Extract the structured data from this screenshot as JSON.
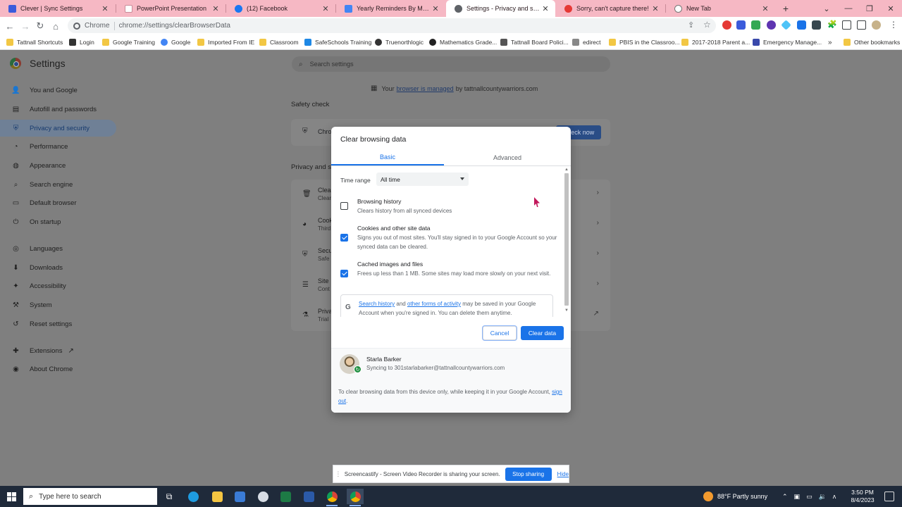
{
  "tabs": [
    {
      "title": "Clever | Sync Settings",
      "favicon_color": "#3b5bdb",
      "active": false
    },
    {
      "title": "PowerPoint Presentation",
      "favicon_color": "#f6b8c4",
      "active": false
    },
    {
      "title": "(12) Facebook",
      "favicon_color": "#1877f2",
      "active": false
    },
    {
      "title": "Yearly Reminders By Month - Go",
      "favicon_color": "#4285f4",
      "active": false
    },
    {
      "title": "Settings - Privacy and security",
      "favicon_color": "#5f6368",
      "active": true
    },
    {
      "title": "Sorry, can't capture there!",
      "favicon_color": "#e53935",
      "active": false
    },
    {
      "title": "New Tab",
      "favicon_color": "#5f6368",
      "active": false
    }
  ],
  "address_bar": {
    "site_label": "Chrome",
    "url": "chrome://settings/clearBrowserData"
  },
  "bookmarks": [
    {
      "label": "Tattnall Shortcuts",
      "color": "#f2c744"
    },
    {
      "label": "Login",
      "color": "#333333"
    },
    {
      "label": "Google Training",
      "color": "#f2c744"
    },
    {
      "label": "Google",
      "color": "#4285f4"
    },
    {
      "label": "Imported From IE",
      "color": "#f2c744"
    },
    {
      "label": "Classroom",
      "color": "#f2c744"
    },
    {
      "label": "SafeSchools Training",
      "color": "#1e88e5"
    },
    {
      "label": "Truenorthlogic",
      "color": "#333333"
    },
    {
      "label": "Mathematics Grade...",
      "color": "#222222"
    },
    {
      "label": "Tattnall Board Polici...",
      "color": "#555555"
    },
    {
      "label": "edirect",
      "color": "#888888"
    },
    {
      "label": "PBIS in the Classroo...",
      "color": "#f2c744"
    },
    {
      "label": "2017-2018 Parent a...",
      "color": "#f2c744"
    },
    {
      "label": "Emergency Manage...",
      "color": "#3949ab"
    }
  ],
  "bookmarks_more": "»",
  "bookmarks_other": "Other bookmarks",
  "settings": {
    "title": "Settings",
    "search_placeholder": "Search settings",
    "nav": [
      {
        "label": "You and Google",
        "icon": "person-icon",
        "glyph": "👤",
        "active": false
      },
      {
        "label": "Autofill and passwords",
        "icon": "autofill-icon",
        "glyph": "▤",
        "active": false
      },
      {
        "label": "Privacy and security",
        "icon": "shield-icon",
        "glyph": "⛨",
        "active": true
      },
      {
        "label": "Performance",
        "icon": "speed-icon",
        "glyph": "◔",
        "active": false
      },
      {
        "label": "Appearance",
        "icon": "palette-icon",
        "glyph": "🎨",
        "active": false
      },
      {
        "label": "Search engine",
        "icon": "search-icon",
        "glyph": "⌕",
        "active": false
      },
      {
        "label": "Default browser",
        "icon": "browser-icon",
        "glyph": "▭",
        "active": false
      },
      {
        "label": "On startup",
        "icon": "power-icon",
        "glyph": "⏻",
        "active": false
      },
      {
        "label": "Languages",
        "icon": "globe-icon",
        "glyph": "🌐",
        "active": false
      },
      {
        "label": "Downloads",
        "icon": "download-icon",
        "glyph": "⬇",
        "active": false
      },
      {
        "label": "Accessibility",
        "icon": "accessibility-icon",
        "glyph": "♿",
        "active": false
      },
      {
        "label": "System",
        "icon": "wrench-icon",
        "glyph": "🔧",
        "active": false
      },
      {
        "label": "Reset settings",
        "icon": "reset-icon",
        "glyph": "↺",
        "active": false
      },
      {
        "label": "Extensions",
        "icon": "puzzle-icon",
        "glyph": "🧩",
        "active": false
      },
      {
        "label": "About Chrome",
        "icon": "chrome-icon",
        "glyph": "◉",
        "active": false
      }
    ],
    "managed_prefix": "Your",
    "managed_link": "browser is managed",
    "managed_suffix": "by tattnallcountywarriors.com",
    "safety_check_heading": "Safety check",
    "safety_row_title": "Chro",
    "check_now_label": "Check now",
    "privacy_heading": "Privacy and s",
    "privacy_rows": [
      {
        "title": "Clear",
        "sub": "Clear",
        "icon": "trash-icon",
        "glyph": "🗑"
      },
      {
        "title": "Cook",
        "sub": "Third",
        "icon": "cookie-icon",
        "glyph": "◕"
      },
      {
        "title": "Secu",
        "sub": "Safe",
        "icon": "shield-icon",
        "glyph": "⛨"
      },
      {
        "title": "Site",
        "sub": "Cont",
        "icon": "sliders-icon",
        "glyph": "☰"
      },
      {
        "title": "Priva",
        "sub": "Trial",
        "icon": "flask-icon",
        "glyph": "⚗"
      }
    ]
  },
  "dialog": {
    "title": "Clear browsing data",
    "tabs": [
      {
        "label": "Basic",
        "active": true
      },
      {
        "label": "Advanced",
        "active": false
      }
    ],
    "time_range_label": "Time range",
    "time_range_value": "All time",
    "options": [
      {
        "title": "Browsing history",
        "desc": "Clears history from all synced devices",
        "checked": false
      },
      {
        "title": "Cookies and other site data",
        "desc": "Signs you out of most sites. You'll stay signed in to your Google Account so your synced data can be cleared.",
        "checked": true
      },
      {
        "title": "Cached images and files",
        "desc": "Frees up less than 1 MB. Some sites may load more slowly on your next visit.",
        "checked": true
      }
    ],
    "google_note": {
      "link1": "Search history",
      "mid": "and",
      "link2": "other forms of activity",
      "rest": "may be saved in your Google Account when you're signed in. You can delete them anytime."
    },
    "cancel_label": "Cancel",
    "clear_label": "Clear data",
    "account_name": "Starla Barker",
    "account_sync": "Syncing to 301starlabarker@tattnallcountywarriors.com",
    "footer_note_text": "To clear browsing data from this device only, while keeping it in your Google Account,",
    "footer_note_link": "sign out",
    "footer_note_end": "."
  },
  "share_bar": {
    "text": "Screencastify - Screen Video Recorder is sharing your screen.",
    "stop_label": "Stop sharing",
    "hide_label": "Hide"
  },
  "taskbar": {
    "search_placeholder": "Type here to search",
    "weather": "88°F  Partly sunny",
    "time": "3:50 PM",
    "date": "8/4/2023"
  }
}
